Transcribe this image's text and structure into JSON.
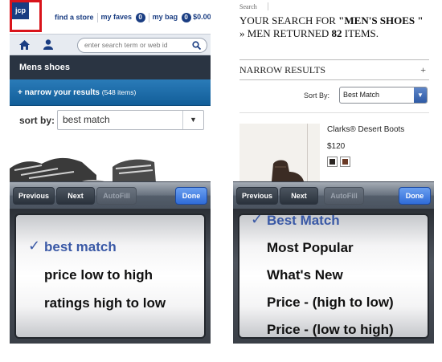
{
  "left": {
    "logo_text": "jcp",
    "links": {
      "find_store": "find a store",
      "faves": "my faves",
      "faves_count": "0",
      "bag": "my bag",
      "bag_count": "0",
      "bag_total": "$0.00"
    },
    "search": {
      "placeholder": "enter search term or web id",
      "icon": "search-icon"
    },
    "nav_icons": [
      "home-icon",
      "user-icon"
    ],
    "category_title": "Mens shoes",
    "narrow": {
      "label": "+ narrow your results",
      "count": "(548 items)"
    },
    "sort": {
      "label": "sort by:",
      "value": "best match"
    },
    "toolbar": {
      "previous": "Previous",
      "next": "Next",
      "autofill": "AutoFill",
      "done": "Done"
    },
    "picker": {
      "check": "✓",
      "options": [
        "best match",
        "price low to high",
        "ratings high to low"
      ],
      "selected_index": 0
    }
  },
  "right": {
    "breadcrumb": "Search",
    "heading": {
      "prefix": "YOUR SEARCH FOR ",
      "query": "\"MEN'S SHOES \"",
      "mid": " » MEN ",
      "returned": "RETURNED ",
      "count": "82",
      "suffix": " ITEMS."
    },
    "narrow_results": {
      "label": "NARROW RESULTS",
      "plus": "+"
    },
    "sort": {
      "label": "Sort By:",
      "value": "Best Match"
    },
    "product": {
      "name": "Clarks® Desert Boots",
      "price": "$120",
      "swatch_colors": [
        "#2b2522",
        "#6b3a26"
      ]
    },
    "toolbar": {
      "previous": "Previous",
      "next": "Next",
      "autofill": "AutoFill",
      "done": "Done"
    },
    "picker": {
      "check": "✓",
      "options": [
        "Best Match",
        "Most Popular",
        "What's New",
        "Price - (high to low)",
        "Price - (low to high)"
      ],
      "selected_index": 0
    }
  },
  "colors": {
    "brand_blue": "#1a3d82",
    "logo_red": "#d9141b",
    "done_blue": "#2f6bd8",
    "selected_text": "#3a59a6"
  }
}
